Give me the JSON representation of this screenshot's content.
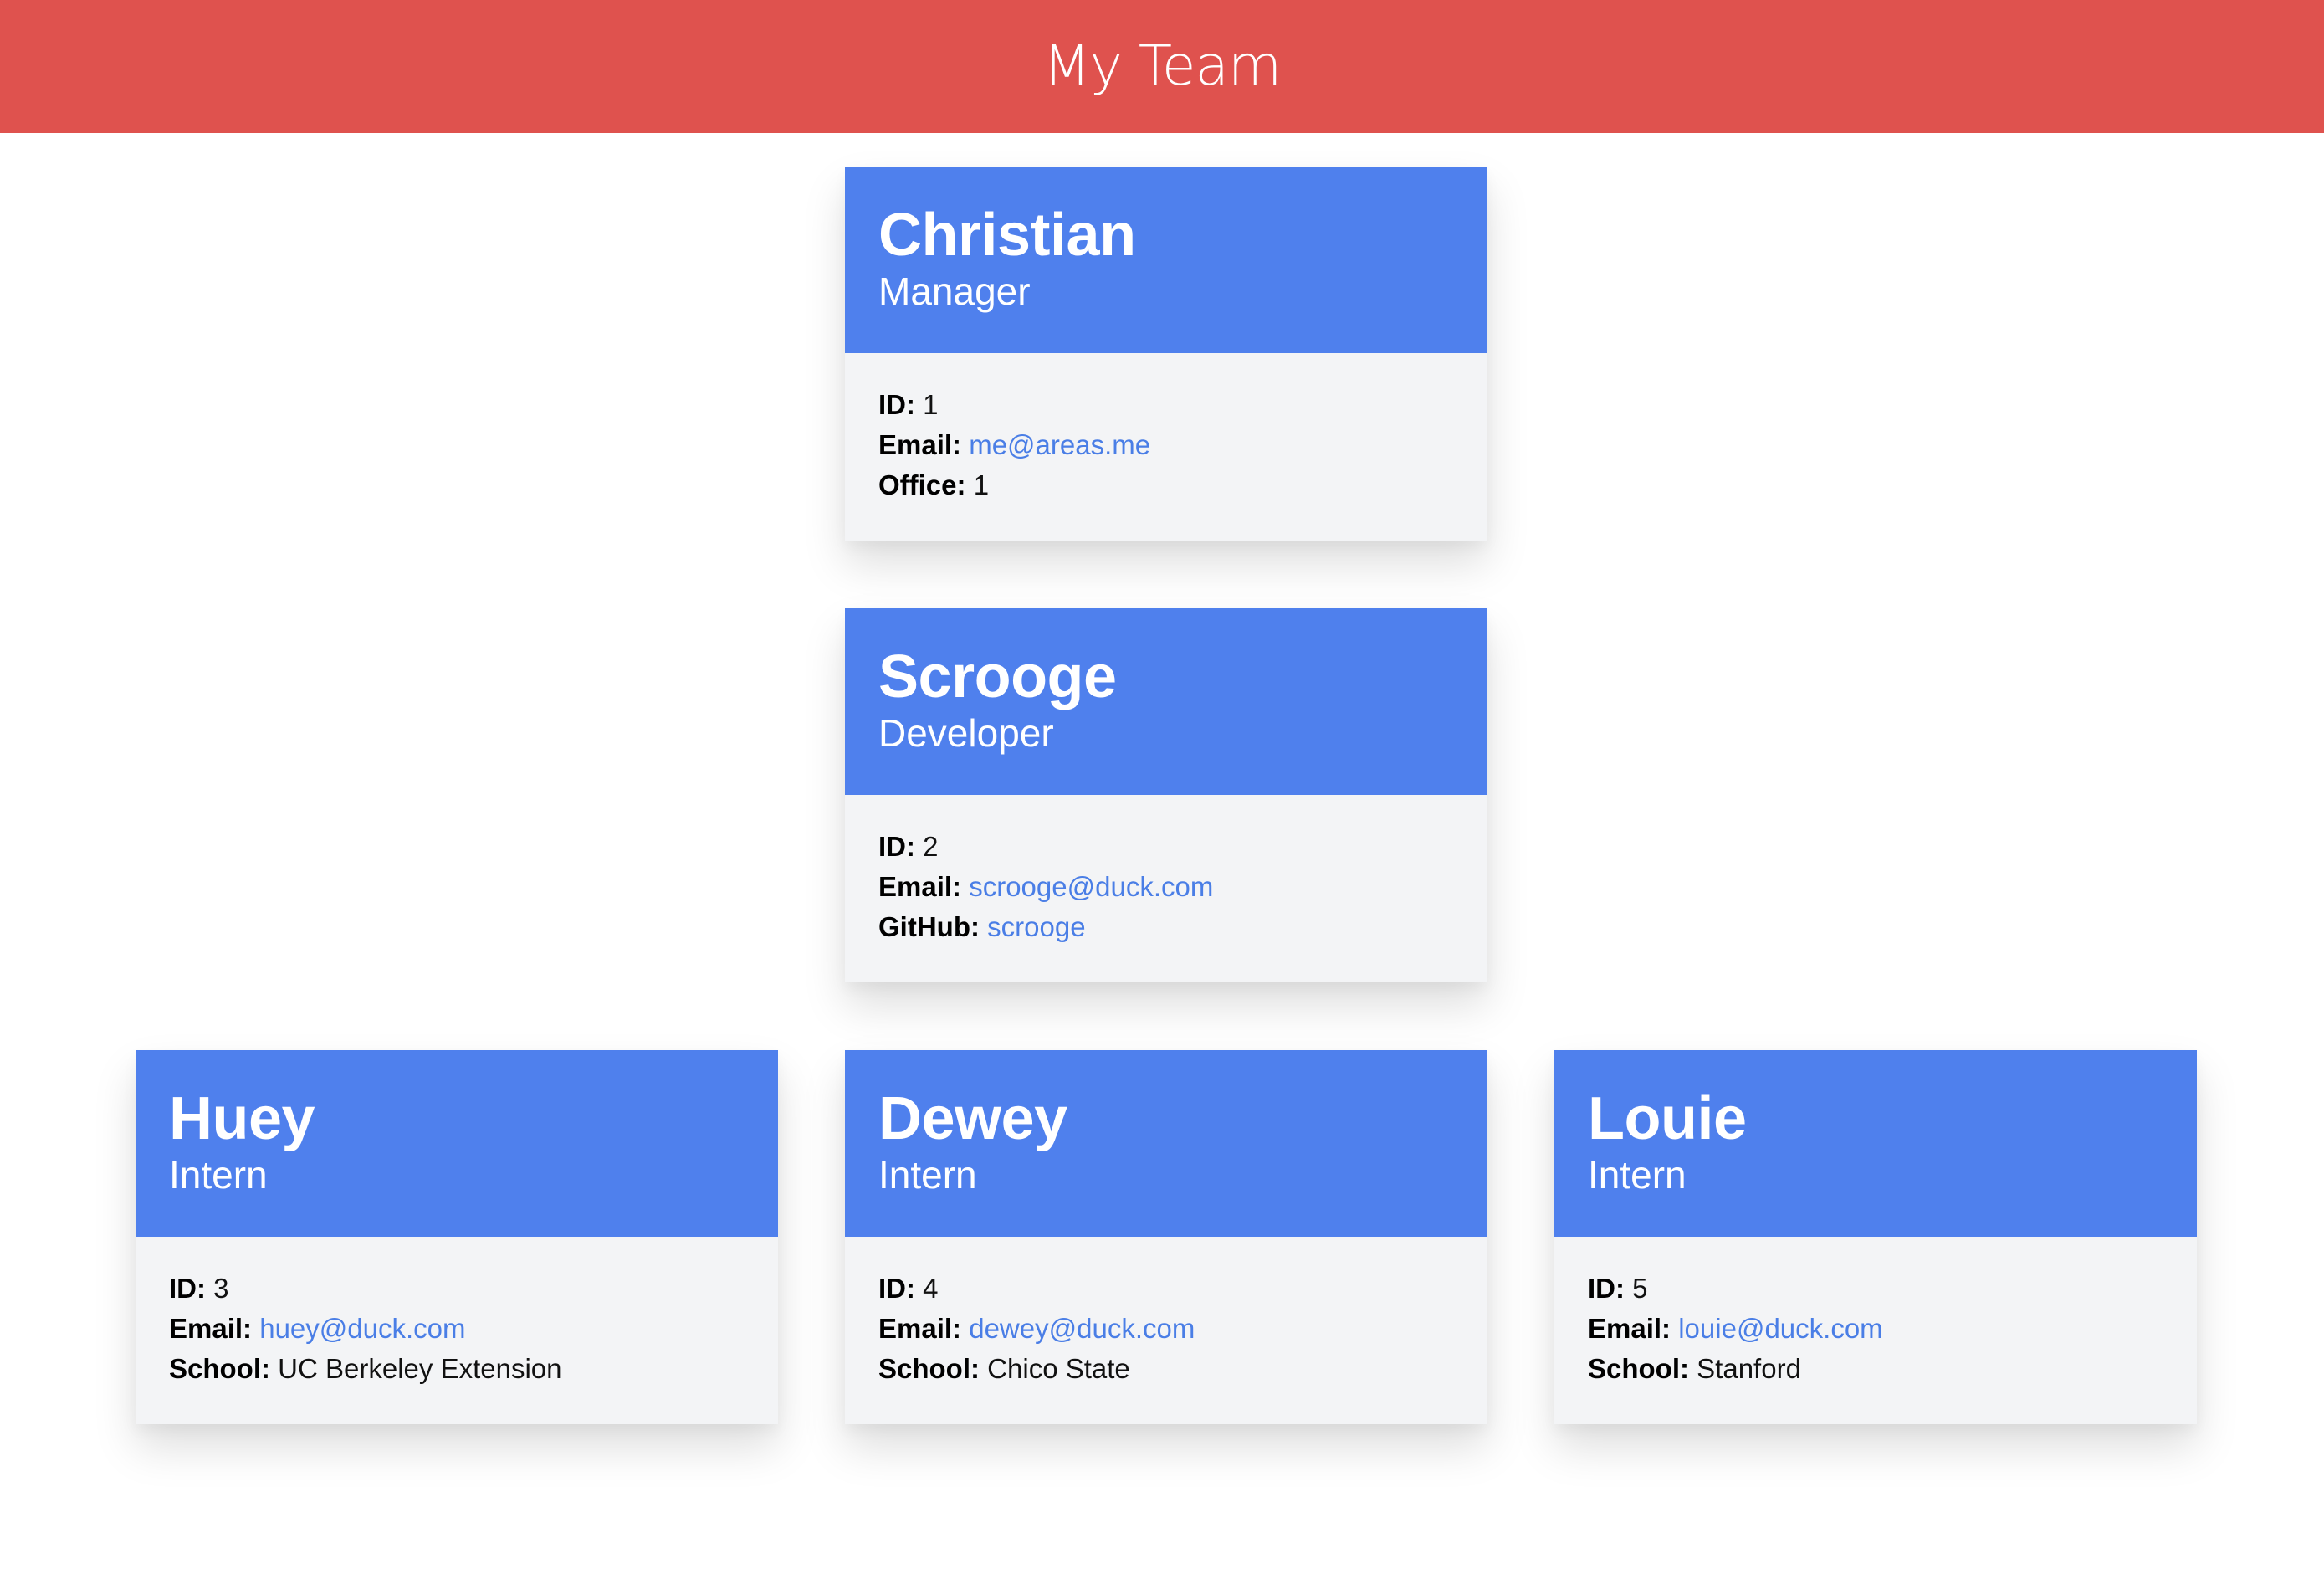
{
  "header": {
    "title": "My Team"
  },
  "labels": {
    "id": "ID:",
    "email": "Email:",
    "office": "Office:",
    "github": "GitHub:",
    "school": "School:"
  },
  "team": {
    "manager": {
      "name": "Christian",
      "role": "Manager",
      "id": "1",
      "email": "me@areas.me",
      "office": "1"
    },
    "engineer": {
      "name": "Scrooge",
      "role": "Developer",
      "id": "2",
      "email": "scrooge@duck.com",
      "github": "scrooge"
    },
    "interns": [
      {
        "name": "Huey",
        "role": "Intern",
        "id": "3",
        "email": "huey@duck.com",
        "school": "UC Berkeley Extension"
      },
      {
        "name": "Dewey",
        "role": "Intern",
        "id": "4",
        "email": "dewey@duck.com",
        "school": "Chico State"
      },
      {
        "name": "Louie",
        "role": "Intern",
        "id": "5",
        "email": "louie@duck.com",
        "school": "Stanford"
      }
    ]
  }
}
